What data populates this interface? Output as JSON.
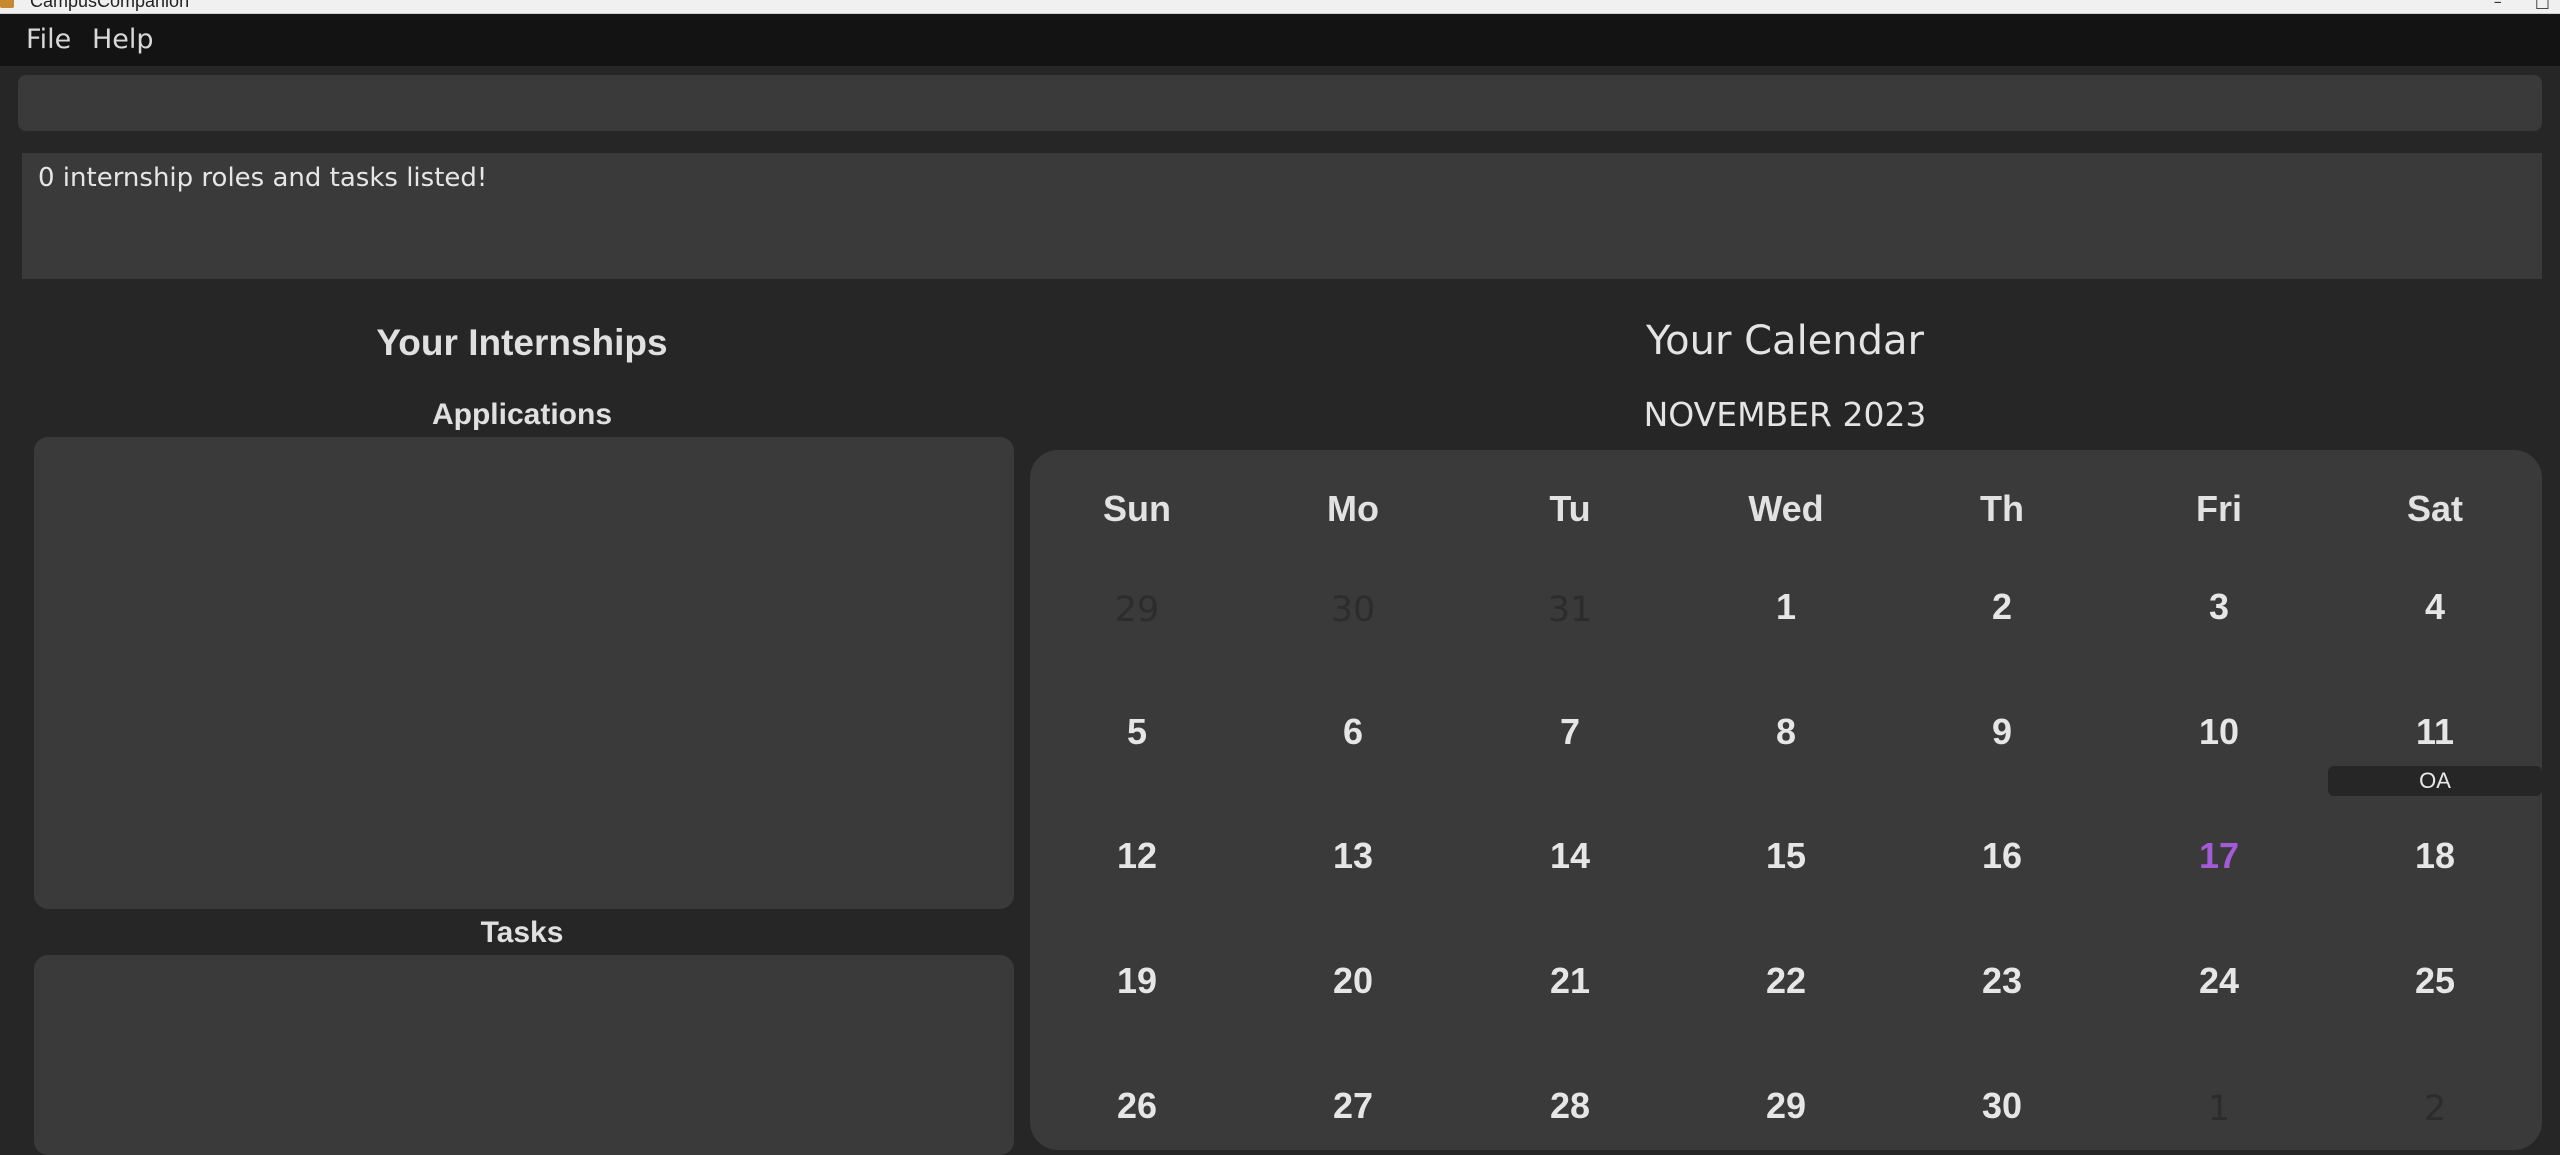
{
  "window": {
    "title": "CampusCompanion",
    "controls": [
      "–",
      "□"
    ]
  },
  "menu": {
    "file": "File",
    "help": "Help"
  },
  "command": {
    "value": "",
    "placeholder": ""
  },
  "result": {
    "message": "0 internship roles and tasks listed!"
  },
  "internships": {
    "title": "Your Internships",
    "applications_label": "Applications",
    "tasks_label": "Tasks"
  },
  "calendar": {
    "title": "Your Calendar",
    "month": "NOVEMBER 2023",
    "weekdays": [
      "Sun",
      "Mo",
      "Tu",
      "Wed",
      "Th",
      "Fri",
      "Sat"
    ],
    "rows": [
      [
        "29",
        "30",
        "31",
        "1",
        "2",
        "3",
        "4"
      ],
      [
        "5",
        "6",
        "7",
        "8",
        "9",
        "10",
        "11"
      ],
      [
        "12",
        "13",
        "14",
        "15",
        "16",
        "17",
        "18"
      ],
      [
        "19",
        "20",
        "21",
        "22",
        "23",
        "24",
        "25"
      ],
      [
        "26",
        "27",
        "28",
        "29",
        "30",
        "1",
        "2"
      ]
    ],
    "today": "17",
    "event": {
      "label": "OA",
      "day": "11"
    },
    "colors": {
      "today": "#a45bd8",
      "other_month": "#2c2c2c"
    }
  }
}
